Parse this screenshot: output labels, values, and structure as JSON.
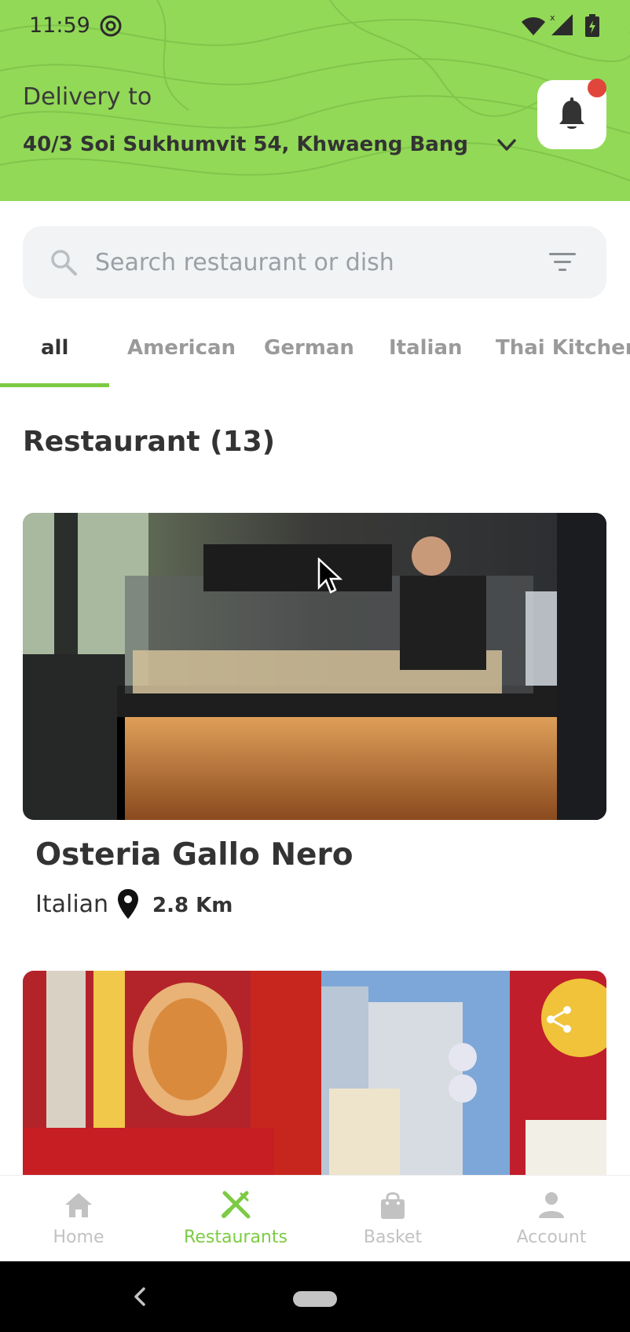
{
  "status_bar": {
    "time": "11:59"
  },
  "header": {
    "delivery_label": "Delivery to",
    "address": "40/3 Soi Sukhumvit 54, Khwaeng Bang Ch...",
    "accent_color": "#92d957"
  },
  "search": {
    "placeholder": "Search restaurant or dish"
  },
  "tabs": [
    {
      "label": "all",
      "active": true
    },
    {
      "label": "American"
    },
    {
      "label": "German"
    },
    {
      "label": "Italian"
    },
    {
      "label": "Thai Kitchen"
    }
  ],
  "section": {
    "title": "Restaurant (13)"
  },
  "restaurants": [
    {
      "name": "Osteria Gallo Nero",
      "cuisine": "Italian",
      "distance": "2.8 Km",
      "image": "restaurant-counter-photo"
    },
    {
      "image": "street-signs-photo"
    }
  ],
  "bottom_nav": [
    {
      "label": "Home",
      "icon": "home-icon"
    },
    {
      "label": "Restaurants",
      "icon": "restaurants-icon",
      "active": true
    },
    {
      "label": "Basket",
      "icon": "basket-icon"
    },
    {
      "label": "Account",
      "icon": "account-icon"
    }
  ]
}
